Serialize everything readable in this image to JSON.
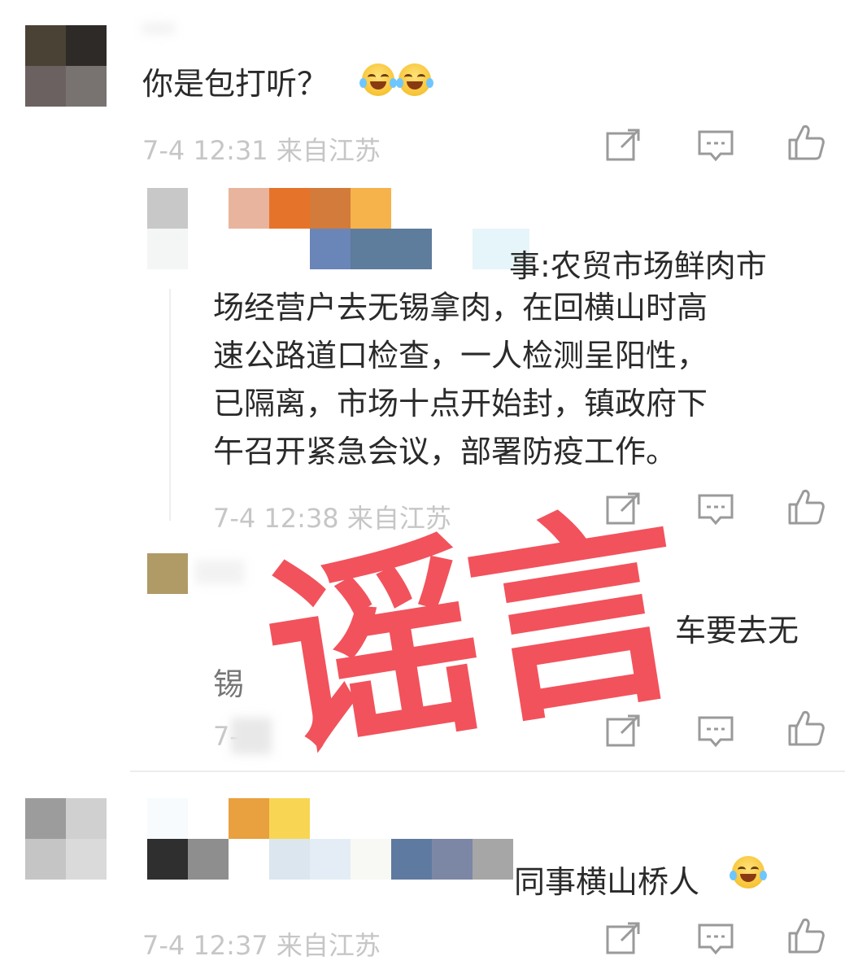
{
  "comment1": {
    "text": "你是包打听？",
    "emojis": [
      "laugh-cry-emoji",
      "laugh-cry-emoji"
    ],
    "meta": "7-4 12:31 来自江苏",
    "avatar_colors": [
      "#4b4236",
      "#2e2a27",
      "#6b6160",
      "#787371"
    ]
  },
  "reply1": {
    "name_colors_row1": [
      "#c8c8c8",
      "#ffffff",
      "#e9b49d",
      "#e6732a",
      "#d27b3a",
      "#f6b24b"
    ],
    "name_colors_row2": [
      "#f4f6f6",
      "#ffffff",
      "#ffffff",
      "#6a86b8",
      "#5e7c9b",
      "#ffffff",
      "#e6f5f9"
    ],
    "text_first_line_tail": "事:农贸市场鲜肉市",
    "text_body": "场经营户去无锡拿肉，在回横山时高速公路道口检查，一人检测呈阳性，已隔离，市场十点开始封，镇政府下午召开紧急会议，部署防疫工作。",
    "lines": [
      "场经营户去无锡拿肉，在回横山时高",
      "速公路道口检查，一人检测呈阳性，",
      "已隔离，市场十点开始封，镇政府下",
      "午召开紧急会议，部署防疫工作。"
    ],
    "meta": "7-4 12:38 来自江苏"
  },
  "reply2": {
    "avatar_color": "#b09a66",
    "text_tail": "车要去无",
    "text_line2_head": "锡",
    "meta": "7-4"
  },
  "comment2": {
    "avatar_colors": [
      "#9c9c9c",
      "#d0d0d0",
      "#c5c5c5",
      "#dadada"
    ],
    "name_colors_row1": [
      "#f7fbfd",
      "#ffffff",
      "#e9a03f",
      "#f8d654"
    ],
    "name_colors_row2": [
      "#2f2f2f",
      "#8e8e8e",
      "#ffffff",
      "#dbe6ef",
      "#e4edf5",
      "#f8f8f5",
      "#5f7aa0",
      "#7c87a6",
      "#a6a6a6"
    ],
    "text_tail": "同事横山桥人",
    "meta": "7-4 12:37 来自江苏"
  },
  "stamp": {
    "text": "谣言",
    "color": "#f24b56"
  },
  "icons": {
    "share": "share-icon",
    "comment": "comment-icon",
    "like": "thumbs-up-icon"
  }
}
